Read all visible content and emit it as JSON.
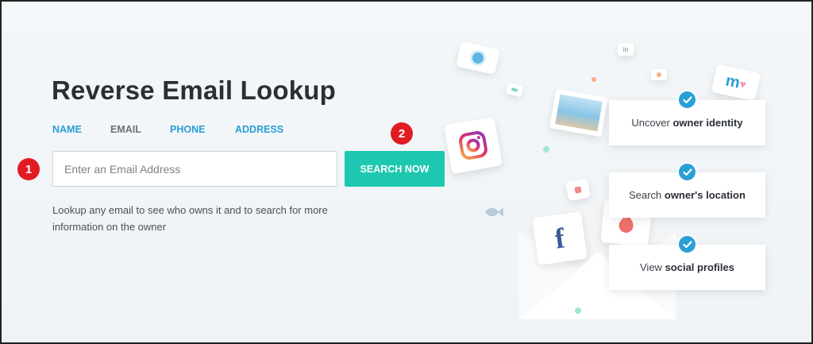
{
  "title": "Reverse Email Lookup",
  "tabs": [
    {
      "label": "NAME",
      "color": "#2a9fd6"
    },
    {
      "label": "EMAIL",
      "color": "#6b7178"
    },
    {
      "label": "PHONE",
      "color": "#2a9fd6"
    },
    {
      "label": "ADDRESS",
      "color": "#2a9fd6"
    }
  ],
  "search": {
    "value": "",
    "placeholder": "Enter an Email Address",
    "button_label": "SEARCH NOW"
  },
  "description": "Lookup any email to see who owns it and to search for more information on the owner",
  "annotations": [
    "1",
    "2"
  ],
  "features": [
    {
      "prefix": "Uncover ",
      "bold": "owner identity"
    },
    {
      "prefix": "Search ",
      "bold": "owner's location"
    },
    {
      "prefix": "View ",
      "bold": "social profiles"
    }
  ],
  "illustration": {
    "icons": [
      "profile-icon",
      "instagram-icon",
      "photo-icon",
      "facebook-icon",
      "tinder-icon",
      "fish-icon",
      "linkedin-icon",
      "m-logo-icon",
      "envelope-icon"
    ],
    "brand_colors": {
      "teal": "#1ec8b0",
      "blue": "#2a9fd6",
      "marker_red": "#e21b23",
      "facebook": "#3b5998"
    }
  }
}
